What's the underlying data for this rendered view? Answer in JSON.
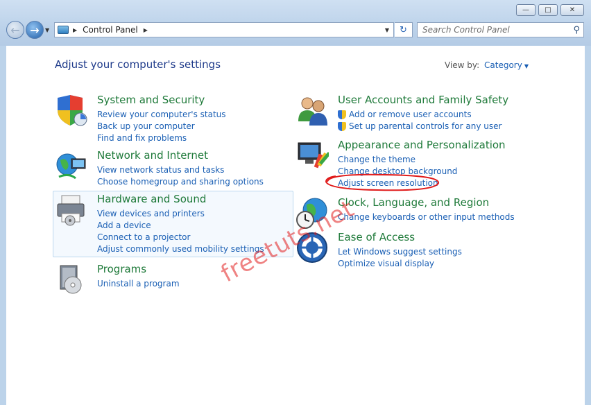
{
  "window": {
    "minimize_label": "—",
    "maximize_label": "□",
    "close_label": "✕"
  },
  "nav": {
    "back_icon": "←",
    "forward_icon": "→",
    "history_dropdown": "▼"
  },
  "address": {
    "path": "Control Panel",
    "separator": "▶",
    "dropdown": "▼",
    "refresh_icon": "↻"
  },
  "search": {
    "placeholder": "Search Control Panel",
    "icon": "⚲"
  },
  "header": {
    "title": "Adjust your computer's settings",
    "view_by_label": "View by:",
    "view_by_value": "Category",
    "view_by_caret": "▼"
  },
  "categories_left": [
    {
      "title": "System and Security",
      "icon": "shield-icon",
      "links": [
        "Review your computer's status",
        "Back up your computer",
        "Find and fix problems"
      ]
    },
    {
      "title": "Network and Internet",
      "icon": "network-globe-icon",
      "links": [
        "View network status and tasks",
        "Choose homegroup and sharing options"
      ]
    },
    {
      "title": "Hardware and Sound",
      "icon": "printer-icon",
      "links": [
        "View devices and printers",
        "Add a device",
        "Connect to a projector",
        "Adjust commonly used mobility settings"
      ]
    },
    {
      "title": "Programs",
      "icon": "programs-disc-icon",
      "links": [
        "Uninstall a program"
      ]
    }
  ],
  "categories_right": [
    {
      "title": "User Accounts and Family Safety",
      "icon": "users-icon",
      "links": [
        "Add or remove user accounts",
        "Set up parental controls for any user"
      ]
    },
    {
      "title": "Appearance and Personalization",
      "icon": "monitor-palette-icon",
      "links": [
        "Change the theme",
        "Change desktop background",
        "Adjust screen resolution"
      ]
    },
    {
      "title": "Clock, Language, and Region",
      "icon": "clock-globe-icon",
      "links": [
        "Change keyboards or other input methods"
      ]
    },
    {
      "title": "Ease of Access",
      "icon": "ease-of-access-icon",
      "links": [
        "Let Windows suggest settings",
        "Optimize visual display"
      ]
    }
  ],
  "watermark": "freetuts.net",
  "colors": {
    "category_title": "#1f7a3a",
    "link": "#1a5fb4",
    "page_title": "#1e3a8a",
    "annotation": "#e01b1b"
  }
}
